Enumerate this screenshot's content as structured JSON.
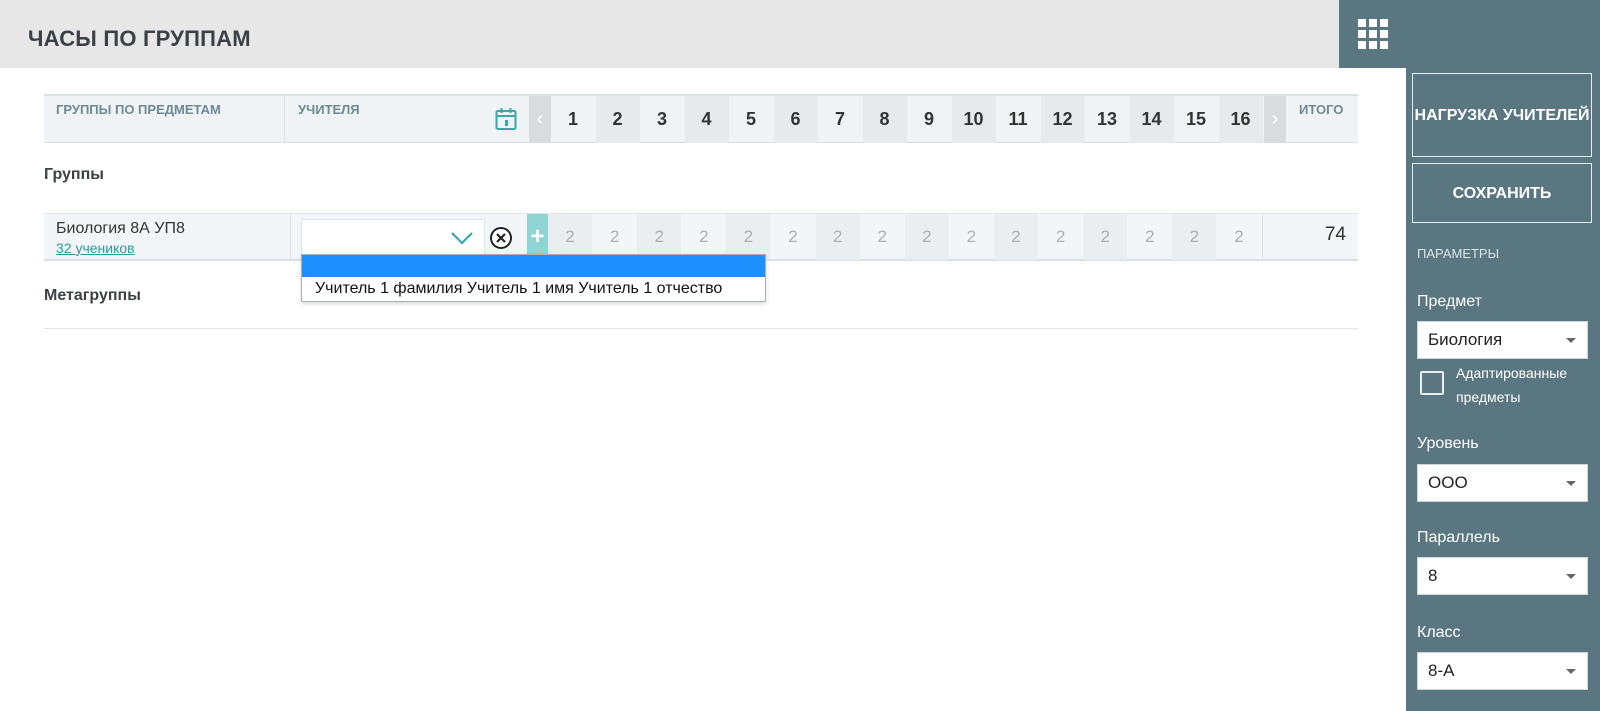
{
  "header": {
    "title": "ЧАСЫ ПО ГРУППАМ",
    "apps_icon": "grid-icon"
  },
  "table": {
    "col_groups": "ГРУППЫ ПО ПРЕДМЕТАМ",
    "col_teachers": "УЧИТЕЛЯ",
    "col_total": "ИТОГО",
    "prev_label": "‹",
    "next_label": "›",
    "weeks": [
      "1",
      "2",
      "3",
      "4",
      "5",
      "6",
      "7",
      "8",
      "9",
      "10",
      "11",
      "12",
      "13",
      "14",
      "15",
      "16"
    ]
  },
  "sections": {
    "groups_label": "Группы",
    "metagroups_label": "Метагруппы"
  },
  "group_row": {
    "name": "Биология 8А УП8",
    "students": "32 учеников",
    "teacher_value": "",
    "add_label": "+",
    "hours": [
      "2",
      "2",
      "2",
      "2",
      "2",
      "2",
      "2",
      "2",
      "2",
      "2",
      "2",
      "2",
      "2",
      "2",
      "2",
      "2"
    ],
    "total": "74"
  },
  "dropdown": {
    "options": [
      "",
      "Учитель 1 фамилия Учитель 1 имя Учитель 1 отчество"
    ]
  },
  "sidebar": {
    "load_button": "НАГРУЗКА УЧИТЕЛЕЙ",
    "save_button": "СОХРАНИТЬ",
    "params_title": "ПАРАМЕТРЫ",
    "subject_label": "Предмет",
    "subject_value": "Биология",
    "adapted_label": "Адаптированные предметы",
    "level_label": "Уровень",
    "level_value": "ООО",
    "parallel_label": "Параллель",
    "parallel_value": "8",
    "class_label": "Класс",
    "class_value": "8-А"
  },
  "colors": {
    "sidebar_bg": "#5a7680",
    "accent_teal": "#2a9aa0",
    "dropdown_highlight": "#1e8fff"
  }
}
